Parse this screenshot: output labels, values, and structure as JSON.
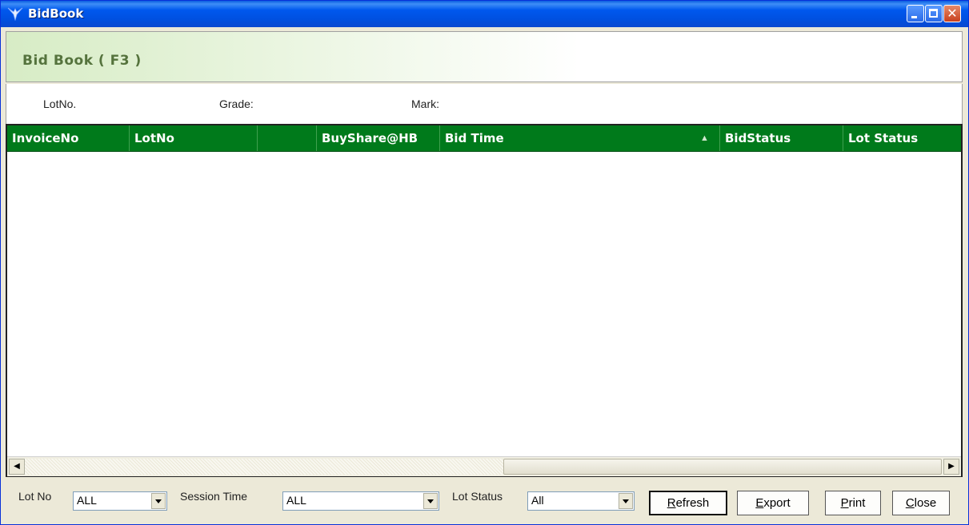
{
  "window": {
    "title": "BidBook"
  },
  "header": {
    "title": "Bid Book ( F3 )"
  },
  "filters": {
    "lotno_label": "LotNo.",
    "grade_label": "Grade:",
    "mark_label": "Mark:"
  },
  "grid": {
    "columns": [
      {
        "label": "InvoiceNo"
      },
      {
        "label": "LotNo"
      },
      {
        "label": ""
      },
      {
        "label": "BuyShare@HB"
      },
      {
        "label": "Bid Time"
      },
      {
        "label": "BidStatus"
      },
      {
        "label": "Lot Status"
      }
    ],
    "sorted_column": "Bid Time",
    "sort_direction": "ascending",
    "rows": []
  },
  "bottom": {
    "lot_no_label": "Lot No",
    "lot_no_value": "ALL",
    "session_time_label": "Session Time",
    "session_time_value": "ALL",
    "lot_status_label": "Lot Status",
    "lot_status_value": "All"
  },
  "buttons": {
    "refresh": {
      "first": "R",
      "rest": "efresh"
    },
    "export": {
      "first": "E",
      "rest": "xport"
    },
    "print": {
      "first": "P",
      "rest": "rint"
    },
    "close": {
      "first": "C",
      "rest": "lose"
    }
  },
  "colors": {
    "header_green": "#007a1b",
    "title_blue": "#0058ee",
    "header_title_green": "#55733d"
  }
}
